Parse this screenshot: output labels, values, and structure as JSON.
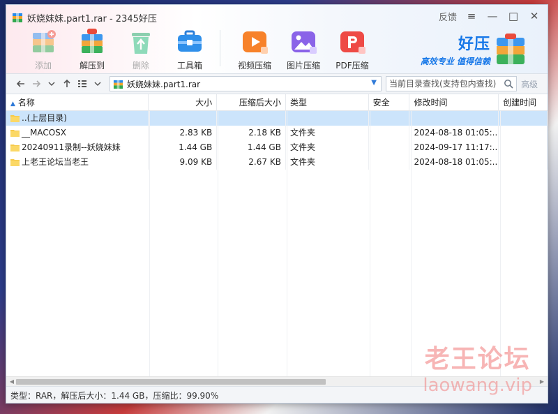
{
  "window": {
    "title": "妖娆妹妹.part1.rar - 2345好压"
  },
  "window_controls": {
    "feedback": "反馈",
    "menu": "≡",
    "minimize": "—",
    "maximize": "□",
    "close": "✕"
  },
  "toolbar": {
    "add": "添加",
    "extract": "解压到",
    "delete": "删除",
    "toolbox": "工具箱",
    "video": "视频压缩",
    "image": "图片压缩",
    "pdf": "PDF压缩"
  },
  "brand": {
    "name": "好压",
    "slogan": "高效专业  值得信赖"
  },
  "navbar": {
    "path": "妖娆妹妹.part1.rar",
    "search_placeholder": "当前目录查找(支持包内查找)",
    "advanced": "高级"
  },
  "table": {
    "columns": [
      "名称",
      "大小",
      "压缩后大小",
      "类型",
      "安全",
      "修改时间",
      "创建时间"
    ],
    "rows": [
      {
        "name": "..(上层目录)",
        "size": "",
        "packed": "",
        "type": "",
        "security": "",
        "modified": "",
        "created": ""
      },
      {
        "name": "__MACOSX",
        "size": "2.83 KB",
        "packed": "2.18 KB",
        "type": "文件夹",
        "security": "",
        "modified": "2024-08-18 01:05:...",
        "created": ""
      },
      {
        "name": "20240911录制--妖娆妹妹",
        "size": "1.44 GB",
        "packed": "1.44 GB",
        "type": "文件夹",
        "security": "",
        "modified": "2024-09-17 11:17:...",
        "created": ""
      },
      {
        "name": "上老王论坛当老王",
        "size": "9.09 KB",
        "packed": "2.67 KB",
        "type": "文件夹",
        "security": "",
        "modified": "2024-08-18 01:05:...",
        "created": ""
      }
    ]
  },
  "statusbar": {
    "text": "类型：RAR，解压后大小：1.44 GB，压缩比：99.90%"
  },
  "watermark": {
    "line1": "老王论坛",
    "line2": "laowang.vip"
  },
  "colors": {
    "accent": "#1677e8",
    "selected_row": "#cce4fb",
    "folder": "#f6c94a"
  }
}
